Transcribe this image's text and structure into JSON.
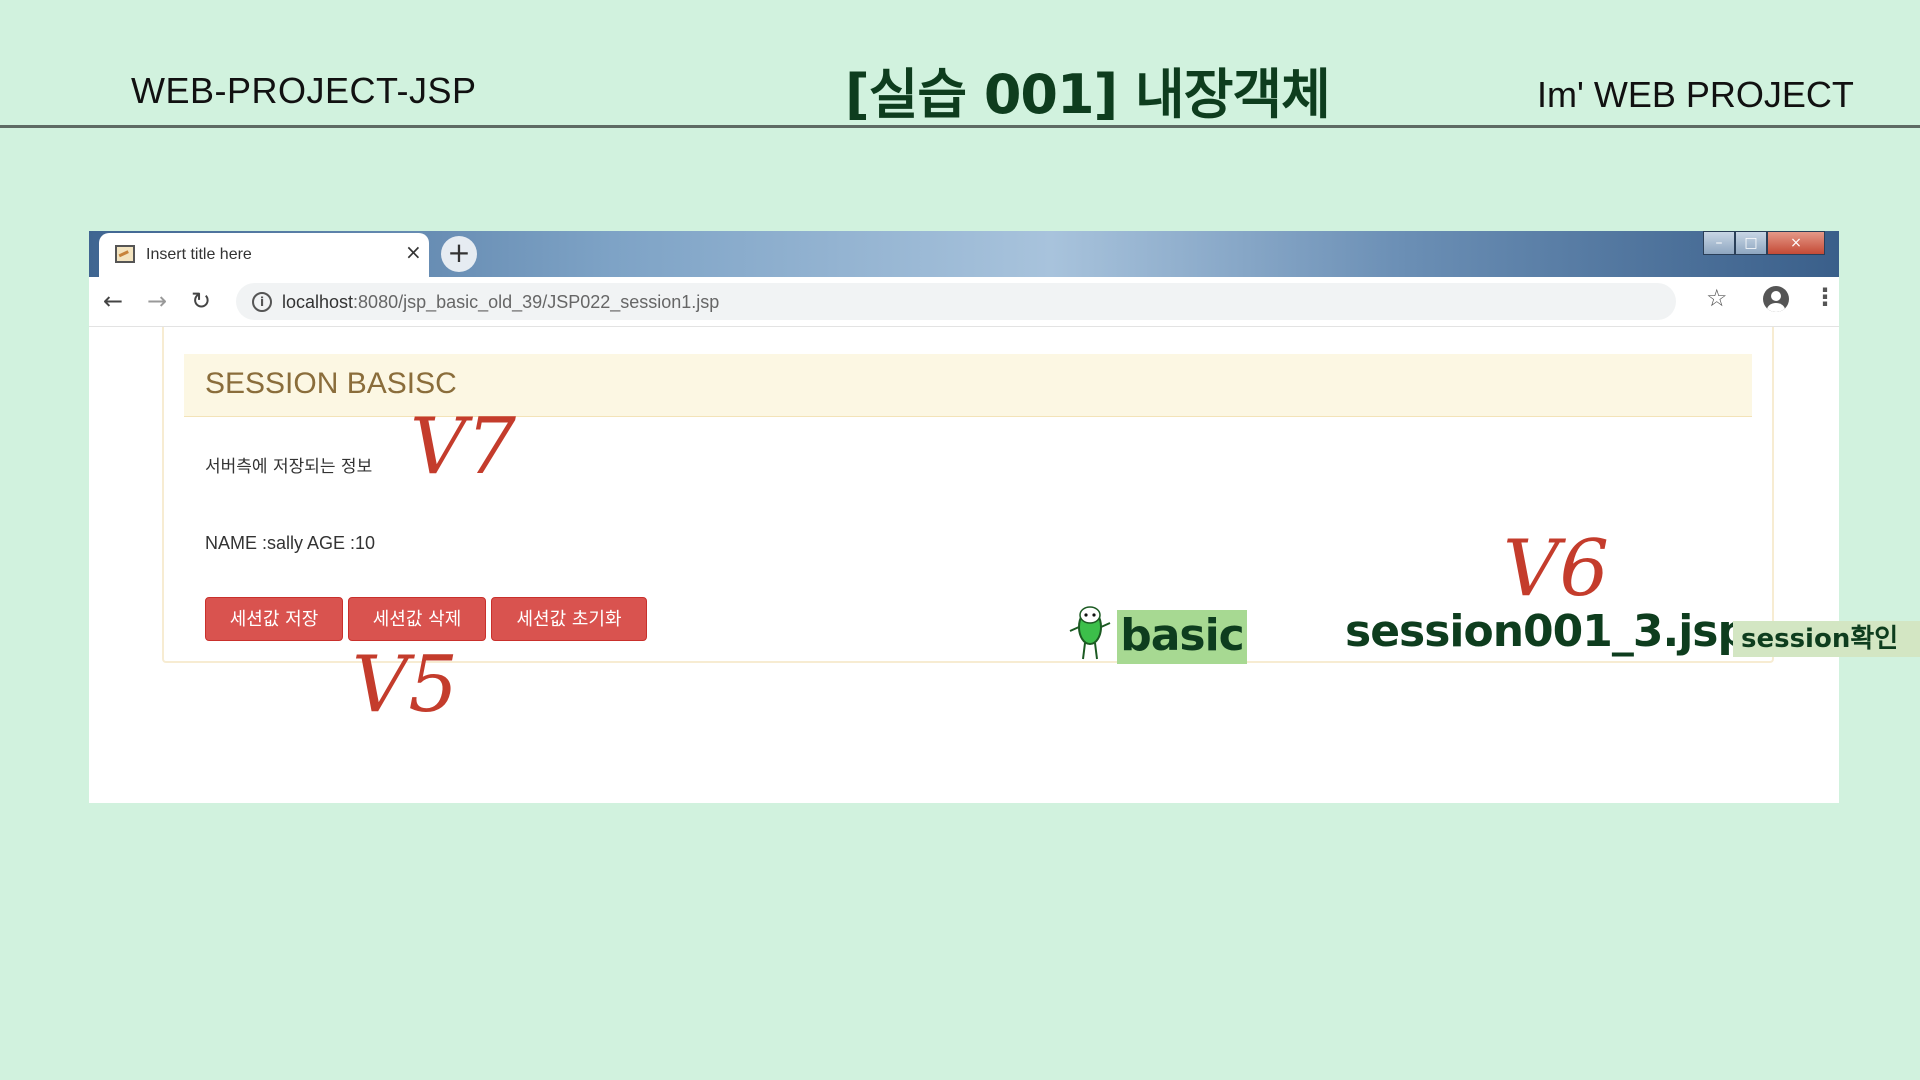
{
  "slide": {
    "left_title": "WEB-PROJECT-JSP",
    "center_title": "[실습 001]  내장객체",
    "right_title": "Im'  WEB PROJECT",
    "background_color": "#d1f2de"
  },
  "browser": {
    "tab_title": "Insert title here",
    "tab_close": "×",
    "new_tab": "+",
    "window_controls": {
      "minimize": "–",
      "maximize": "□",
      "close": "×"
    },
    "nav": {
      "back": "←",
      "forward": "→",
      "reload": "↻"
    },
    "url_host": "localhost",
    "url_path": ":8080/jsp_basic_old_39/JSP022_session1.jsp",
    "info_glyph": "i",
    "star": "☆",
    "menu": "⋮"
  },
  "page": {
    "panel_title": "SESSION BASISC",
    "description": "서버측에 저장되는 정보",
    "name_age": "NAME :sally AGE :10",
    "buttons": {
      "save": "세션값 저장",
      "delete": "세션값 삭제",
      "reset": "세션값 초기화"
    },
    "button_color": "#d9534f"
  },
  "annotations": {
    "v7": "V7",
    "v6": "V6",
    "v5": "V5",
    "basic": "basic",
    "session_file": "session001_3.jsp",
    "session_check": "session확인",
    "accent_color": "#c43c2c"
  }
}
